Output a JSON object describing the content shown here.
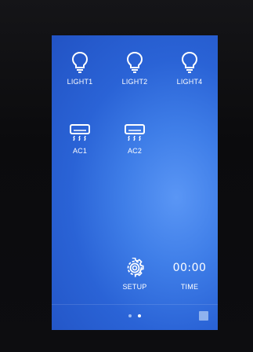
{
  "tiles": {
    "light1": {
      "label": "LIGHT1",
      "icon": "bulb-icon"
    },
    "light2": {
      "label": "LIGHT2",
      "icon": "bulb-icon"
    },
    "light4": {
      "label": "LIGHT4",
      "icon": "bulb-icon"
    },
    "ac1": {
      "label": "AC1",
      "icon": "ac-unit-icon"
    },
    "ac2": {
      "label": "AC2",
      "icon": "ac-unit-icon"
    },
    "setup": {
      "label": "SETUP",
      "icon": "gear-icon"
    },
    "time": {
      "label": "TIME",
      "value": "00:00"
    }
  },
  "pager": {
    "pages": 2,
    "current_page": 2
  },
  "colors": {
    "screen_background": "#2f6fe0",
    "text": "#ffffff",
    "active_dot": "#ffffff",
    "inactive_dot": "#9fbdf2",
    "home_button": "#8fb2ee"
  }
}
